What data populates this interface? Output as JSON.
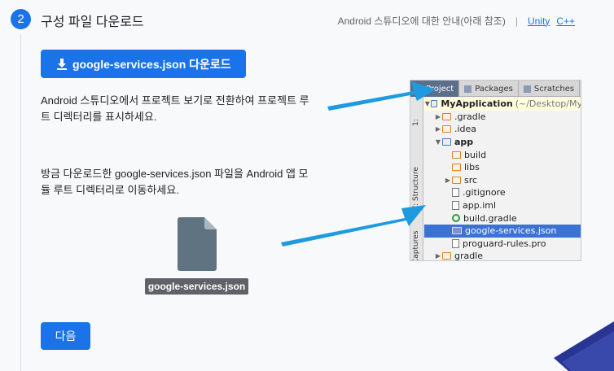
{
  "step": {
    "number": "2",
    "title": "구성 파일 다운로드"
  },
  "header": {
    "guide_text": "Android 스튜디오에 대한 안내(아래 참조)",
    "separator": "|",
    "links": [
      "Unity",
      "C++"
    ]
  },
  "download_button": {
    "label": "google-services.json",
    "suffix": " 다운로드",
    "icon": "download-icon"
  },
  "instructions": [
    "Android 스튜디오에서 프로젝트 보기로 전환하여 프로젝트 루트 디렉터리를 표시하세요.",
    "방금 다운로드한 google-services.json 파일을 Android 앱 모듈 루트 디렉터리로 이동하세요."
  ],
  "file_chip": {
    "label": "google-services.json"
  },
  "next_button": {
    "label": "다음"
  },
  "ide": {
    "tabs": [
      "Project",
      "Packages",
      "Scratches"
    ],
    "side_labels": [
      "1:",
      "Z: Structure",
      "Captures"
    ],
    "tree": {
      "root_name": "MyApplication",
      "root_path": "(~/Desktop/My",
      "rows": [
        ".gradle",
        ".idea",
        "app",
        "build",
        "libs",
        "src",
        ".gitignore",
        "app.iml",
        "build.gradle",
        "google-services.json",
        "proguard-rules.pro",
        "gradle"
      ]
    }
  },
  "colors": {
    "accent": "#1a73e8",
    "chip": "#5f6368",
    "arrow": "#1e9be0",
    "selected_row": "#3b72d4"
  }
}
